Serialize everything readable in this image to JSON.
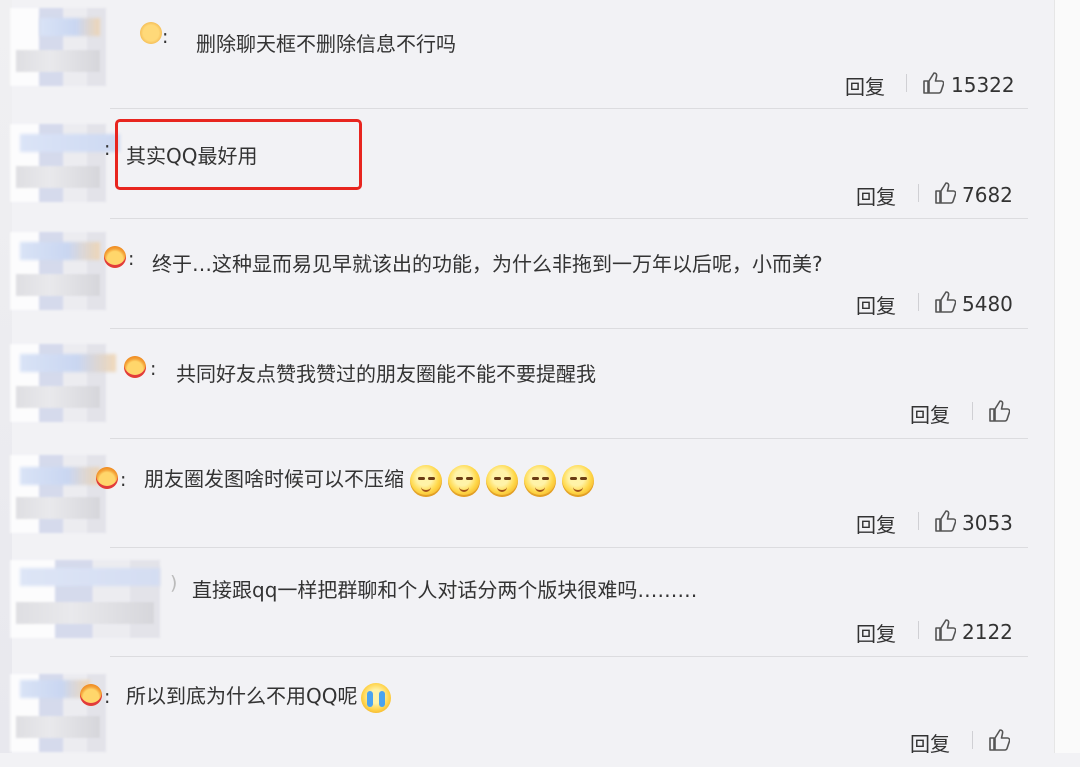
{
  "reply_label": "回复",
  "comments": [
    {
      "text": "删除聊天框不删除信息不行吗",
      "likes": "15322",
      "emojis": 0
    },
    {
      "text": "其实QQ最好用",
      "likes": "7682",
      "emojis": 0
    },
    {
      "text": "终于…这种显而易见早就该出的功能，为什么非拖到一万年以后呢，小而美?",
      "likes": "5480",
      "emojis": 0
    },
    {
      "text": "共同好友点赞我赞过的朋友圈能不能不要提醒我",
      "likes": "",
      "emojis": 0
    },
    {
      "text": "朋友圈发图啥时候可以不压缩",
      "likes": "3053",
      "emojis": 5
    },
    {
      "text": "直接跟qq一样把群聊和个人对话分两个版块很难吗………",
      "likes": "2122",
      "emojis": 0
    },
    {
      "text": "所以到底为什么不用QQ呢",
      "likes": "",
      "emojis": 1
    }
  ],
  "colors": {
    "highlight_border": "#e8251f",
    "text": "#333333",
    "background": "#f2f2f5"
  }
}
